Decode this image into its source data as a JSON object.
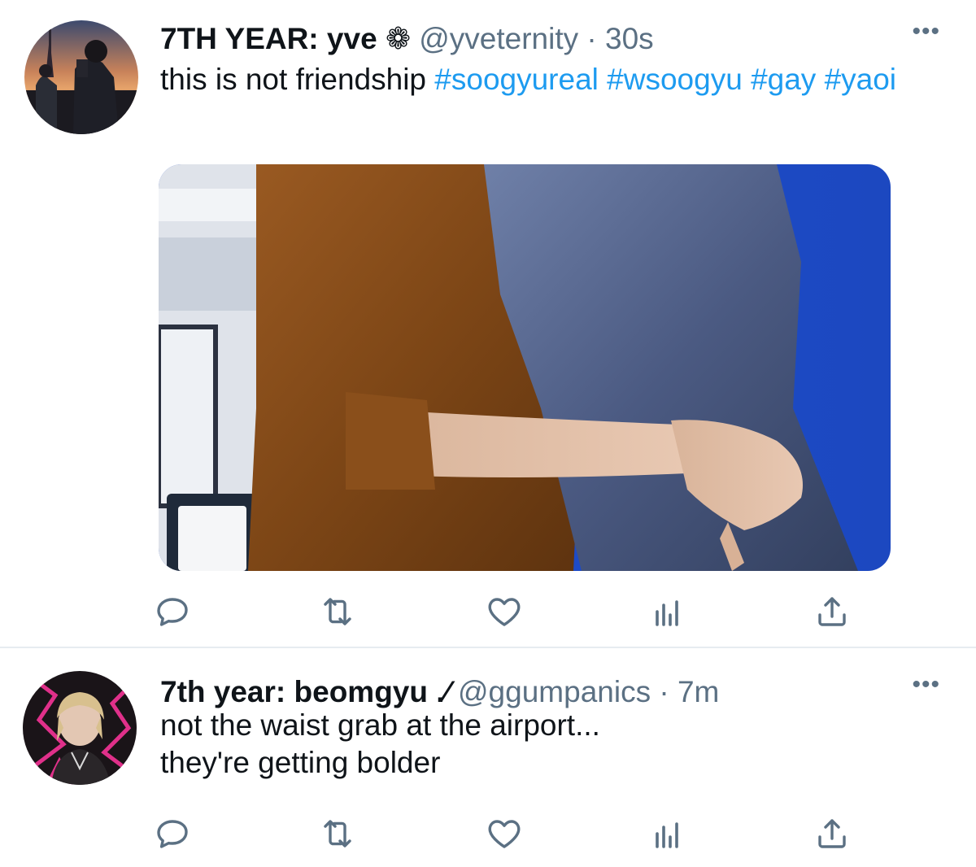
{
  "tweets": [
    {
      "display_name": "7TH YEAR: yve",
      "badge": "❁",
      "handle": "@yveternity",
      "separator": "·",
      "time": "30s",
      "text_plain": "this is not friendship",
      "hashtags": [
        "#soogyureal",
        "#wsoogyu",
        "#gay",
        "#yaoi"
      ],
      "has_media": true
    },
    {
      "display_name": "7th year: beomgyu .⁄",
      "handle": "@ggumpanics",
      "separator": "·",
      "time": "7m",
      "text_line1": "not the waist grab at the airport...",
      "text_line2": "they're getting bolder"
    }
  ],
  "more_label": "•••",
  "actions": {
    "reply_icon": "reply-icon",
    "retweet_icon": "retweet-icon",
    "like_icon": "heart-icon",
    "stats_icon": "analytics-icon",
    "share_icon": "share-icon"
  },
  "colors": {
    "hashtag": "#1d9bf0",
    "secondary_text": "#5b7083",
    "primary_text": "#0f1419",
    "divider": "#e6ecf0"
  }
}
